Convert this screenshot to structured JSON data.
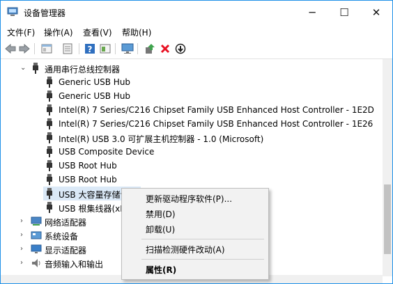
{
  "window": {
    "title": "设备管理器",
    "controls": {
      "minimize": "─",
      "maximize": "☐",
      "close": "✕"
    }
  },
  "menubar": [
    {
      "label": "文件(F)"
    },
    {
      "label": "操作(A)"
    },
    {
      "label": "查看(V)"
    },
    {
      "label": "帮助(H)"
    }
  ],
  "toolbar": {
    "icons": [
      "back-icon",
      "forward-icon",
      "properties-icon",
      "show-hidden-icon",
      "help-icon",
      "action-icon",
      "monitor-icon",
      "update-driver-icon",
      "uninstall-icon",
      "disable-icon"
    ]
  },
  "tree": {
    "category_usb": "通用串行总线控制器",
    "usb_children": [
      "Generic USB Hub",
      "Generic USB Hub",
      "Intel(R) 7 Series/C216 Chipset Family USB Enhanced Host Controller - 1E2D",
      "Intel(R) 7 Series/C216 Chipset Family USB Enhanced Host Controller - 1E26",
      "Intel(R) USB 3.0 可扩展主机控制器 - 1.0 (Microsoft)",
      "USB Composite Device",
      "USB Root Hub",
      "USB Root Hub",
      "USB 大容量存储设备",
      "USB 根集线器(xHCI)"
    ],
    "other_categories": [
      {
        "label": "网络适配器",
        "icon": "network-adapter-icon"
      },
      {
        "label": "系统设备",
        "icon": "system-devices-icon"
      },
      {
        "label": "显示适配器",
        "icon": "display-adapter-icon"
      },
      {
        "label": "音频输入和输出",
        "icon": "audio-icon"
      }
    ]
  },
  "context_menu": {
    "update_driver": "更新驱动程序软件(P)...",
    "disable": "禁用(D)",
    "uninstall": "卸载(U)",
    "scan": "扫描检测硬件改动(A)",
    "properties": "属性(R)"
  },
  "colors": {
    "selection": "#dbe9f7",
    "accent": "#1e90e8",
    "red_x": "#e81123"
  }
}
